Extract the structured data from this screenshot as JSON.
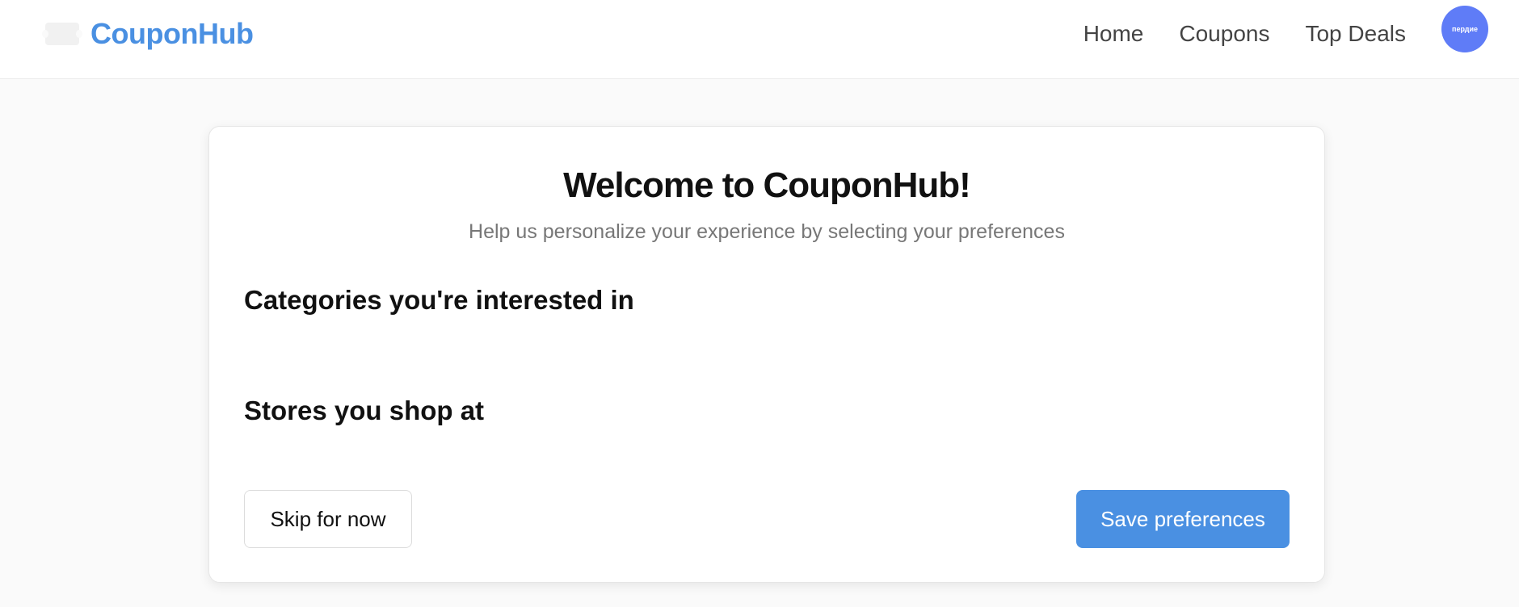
{
  "header": {
    "logo_text": "CouponHub",
    "nav": {
      "home": "Home",
      "coupons": "Coupons",
      "top_deals": "Top Deals"
    },
    "avatar_text": "пердие"
  },
  "onboarding": {
    "title": "Welcome to CouponHub!",
    "subtitle": "Help us personalize your experience by selecting your preferences",
    "categories_title": "Categories you're interested in",
    "stores_title": "Stores you shop at",
    "skip_label": "Skip for now",
    "save_label": "Save preferences"
  },
  "colors": {
    "brand": "#4a90e2",
    "avatar": "#5f7cf7"
  },
  "icons": {
    "logo": "ticket-icon"
  }
}
